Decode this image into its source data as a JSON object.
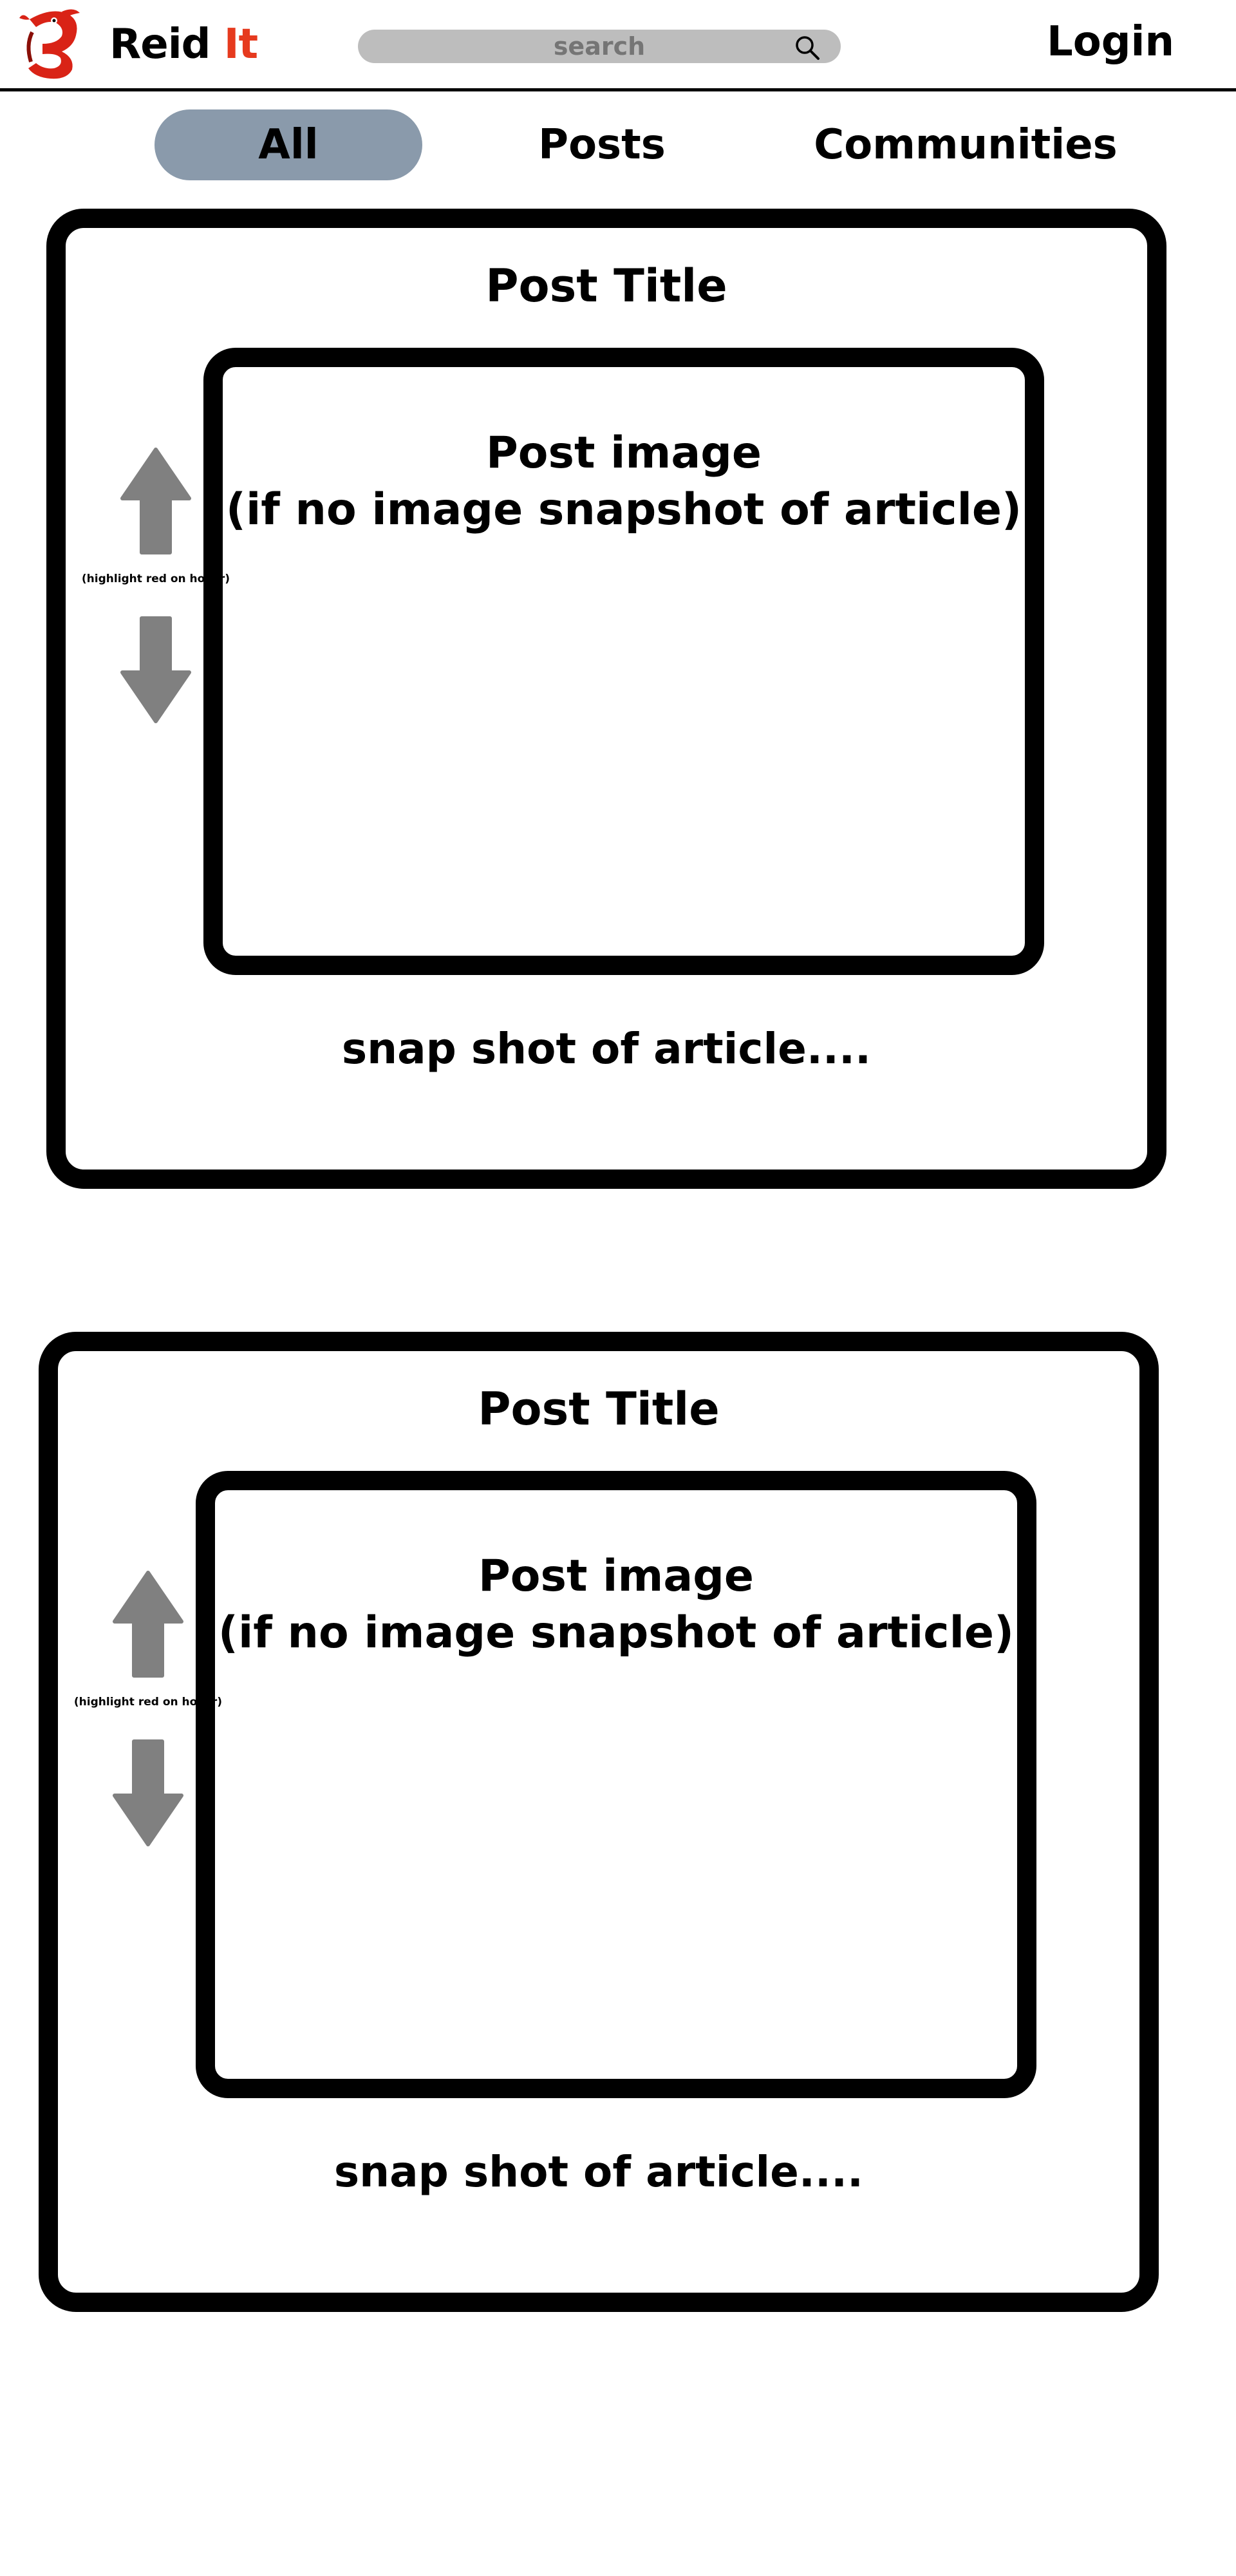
{
  "app": {
    "brand_main": "Reid ",
    "brand_accent": "It",
    "accent_color": "#e63a1e",
    "logo_icon": "red-mascot-logo"
  },
  "header": {
    "search": {
      "placeholder": "search",
      "icon": "search-icon"
    },
    "login_label": "Login"
  },
  "tabs": [
    {
      "label": "All",
      "active": true
    },
    {
      "label": "Posts",
      "active": false
    },
    {
      "label": "Communities",
      "active": false
    }
  ],
  "colors": {
    "active_tab_bg": "#8a9aab",
    "search_bg": "#bdbdbd",
    "vote_arrow": "#808080"
  },
  "posts": [
    {
      "title": "Post Title",
      "image_line1": "Post image",
      "image_line2": "(if no image snapshot of article)",
      "vote_hint": "(highlight red on hover)",
      "snapshot": "snap shot of article...."
    },
    {
      "title": "Post Title",
      "image_line1": "Post image",
      "image_line2": "(if no image snapshot of article)",
      "vote_hint": "(highlight red on hover)",
      "snapshot": "snap shot of article...."
    }
  ]
}
